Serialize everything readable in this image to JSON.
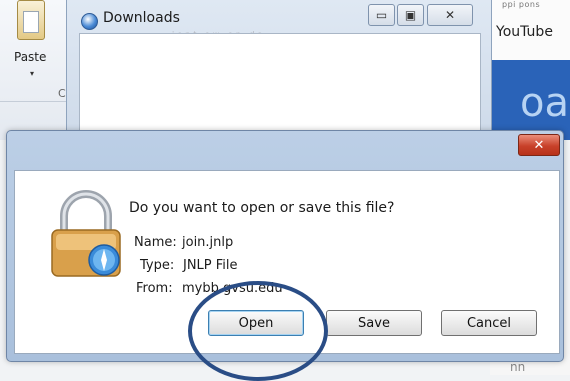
{
  "ribbon": {
    "paste_label": "Paste",
    "paste_arrow": "▾",
    "group_label": "Cl"
  },
  "browser": {
    "top_text": "ppi pons",
    "youtube_link": "YouTube",
    "banner_text": "oa",
    "bottom_text": "nn"
  },
  "downloads_window": {
    "title": "Downloads",
    "faint_text": "ient ow on ds",
    "min_glyph": "▭",
    "max_glyph": "▣",
    "close_glyph": "✕"
  },
  "dialog": {
    "close_glyph": "✕",
    "question": "Do you want to open or save this file?",
    "name_label": "Name:",
    "name_value": "join.jnlp",
    "type_label": "Type:",
    "type_value": "JNLP File",
    "from_label": "From:",
    "from_value": "mybb.gvsu.edu",
    "buttons": {
      "open": "Open",
      "save": "Save",
      "cancel": "Cancel"
    }
  },
  "colors": {
    "highlight_ring": "#2a4d86",
    "close_button": "#c8412a",
    "banner": "#2a63b8"
  }
}
